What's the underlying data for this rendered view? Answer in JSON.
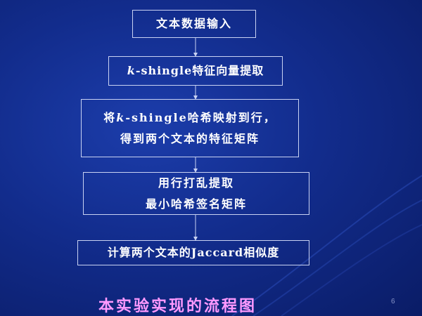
{
  "steps": [
    {
      "lines": [
        "文本数据输入"
      ]
    },
    {
      "lines": [
        "k-shingle特征向量提取"
      ]
    },
    {
      "lines": [
        "将k-shingle哈希映射到行，",
        "得到两个文本的特征矩阵"
      ]
    },
    {
      "lines": [
        "用行打乱提取",
        "最小哈希签名矩阵"
      ]
    },
    {
      "lines": [
        "计算两个文本的Jaccard相似度"
      ]
    }
  ],
  "caption": "本实验实现的流程图",
  "page_number": "6",
  "colors": {
    "background": "#122c8c",
    "box_border": "#c9d2f2",
    "text": "#ffffff",
    "caption": "#ff99ff"
  }
}
